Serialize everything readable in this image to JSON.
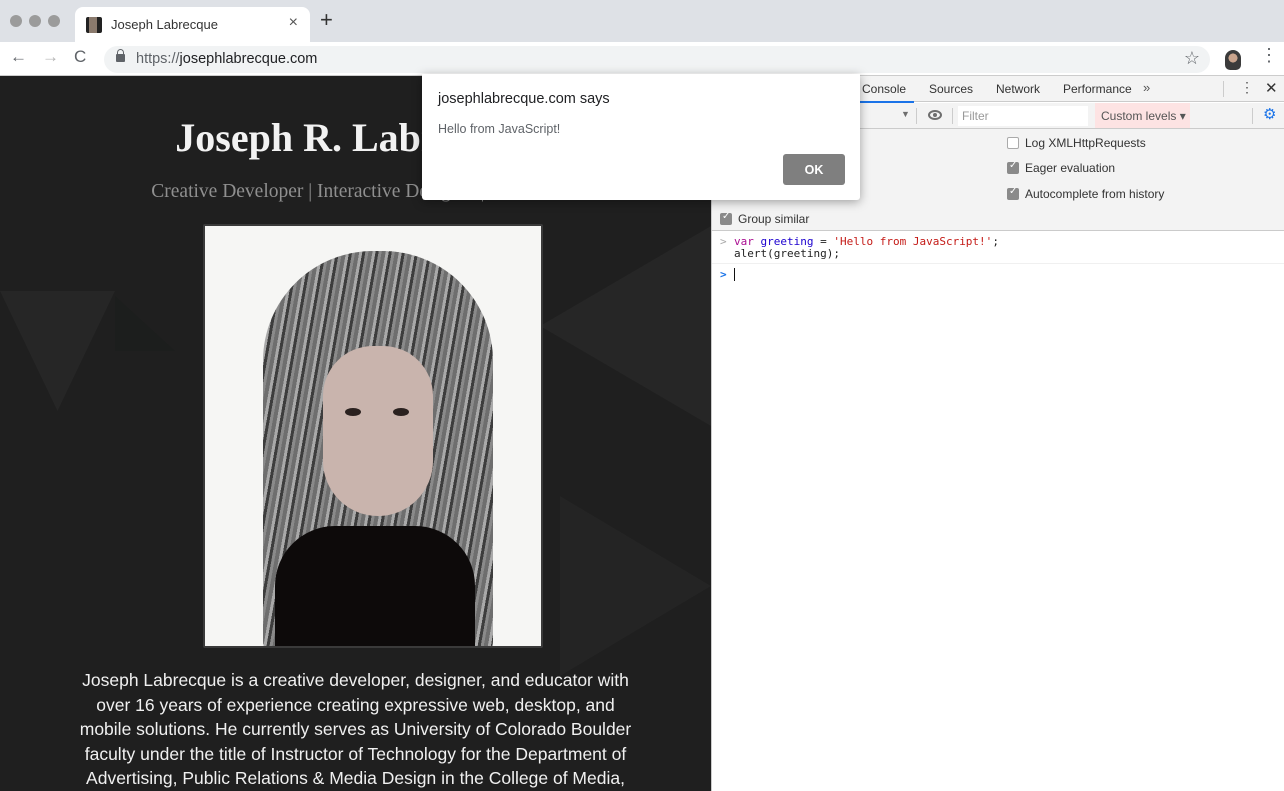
{
  "browser": {
    "tab": {
      "title": "Joseph Labrecque",
      "close_label": "×"
    },
    "new_tab_label": "+",
    "nav": {
      "back": "←",
      "forward": "→",
      "reload": "C"
    },
    "url": {
      "scheme": "https://",
      "host": "josephlabrecque.com"
    },
    "star": "☆",
    "menu": "⋮"
  },
  "page": {
    "title": "Joseph R. Labrecque",
    "subtitle": "Creative Developer | Interactive Designer | Educator",
    "bio": "Joseph Labrecque is a creative developer, designer, and educator with over 16 years of experience creating expressive web, desktop, and mobile solutions. He currently serves as University of Colorado Boulder faculty under the title of Instructor of Technology for the Department of Advertising, Public Relations & Media Design in the College of Media,"
  },
  "devtools": {
    "tabs": [
      "Console",
      "Sources",
      "Network",
      "Performance"
    ],
    "active_tab": "Console",
    "more_tabs": "»",
    "kebab": "⋮",
    "close": "✕",
    "filter_placeholder": "Filter",
    "levels_label": "Custom levels ▾",
    "context_arrow": "▼",
    "gear": "⚙",
    "settings": [
      {
        "label": "Log XMLHttpRequests",
        "checked": false
      },
      {
        "label": "Eager evaluation",
        "checked": true
      },
      {
        "label": "Autocomplete from history",
        "checked": true
      },
      {
        "label": "Group similar",
        "checked": true
      }
    ],
    "console": {
      "entry": {
        "keyword": "var",
        "variable": "greeting",
        "operator": " = ",
        "string": "'Hello from JavaScript!'",
        "terminator": ";",
        "line2": "alert(greeting);"
      },
      "prompt": ">"
    }
  },
  "alert": {
    "title": "josephlabrecque.com says",
    "message": "Hello from JavaScript!",
    "ok_label": "OK"
  }
}
